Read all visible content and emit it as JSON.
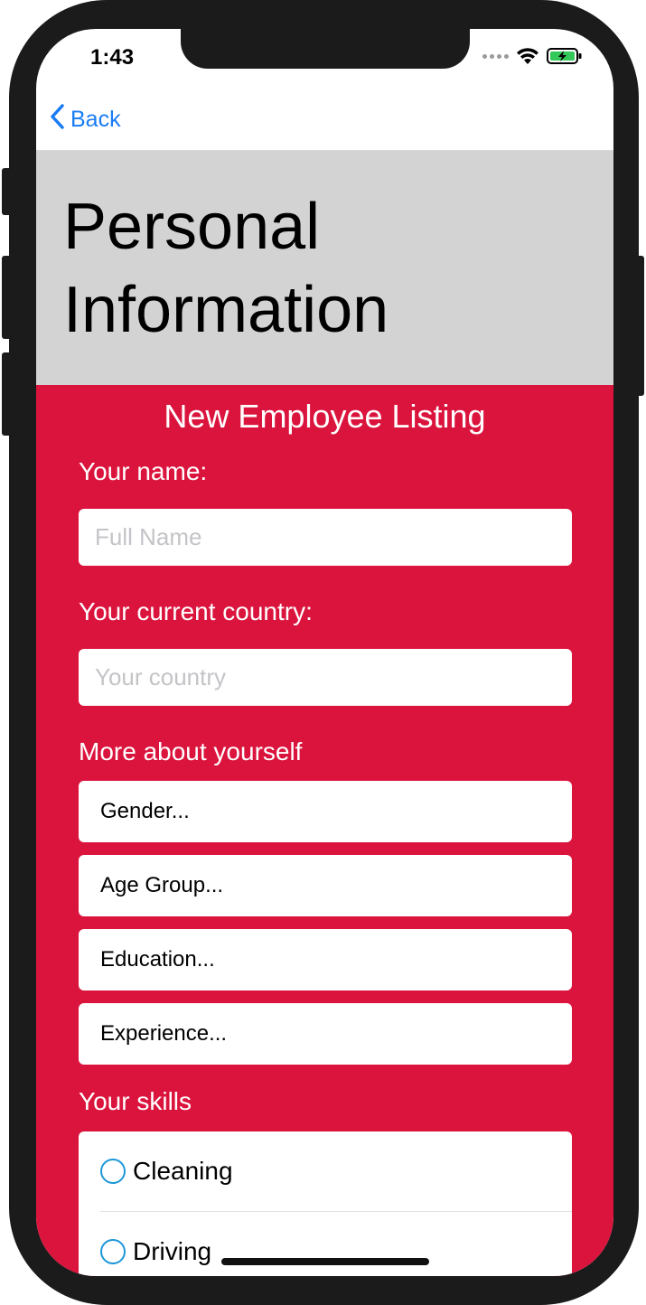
{
  "status_bar": {
    "time": "1:43",
    "signal_icon": "signal-dots-icon",
    "wifi_icon": "wifi-icon",
    "battery_icon": "battery-charging-icon"
  },
  "nav": {
    "back_label": "Back",
    "back_icon": "chevron-left-icon",
    "accent": "#1a7cf5"
  },
  "header": {
    "title": "Personal Information",
    "background": "#d3d3d3"
  },
  "form": {
    "background": "#db143d",
    "listing_title": "New Employee Listing",
    "name_label": "Your name:",
    "name_placeholder": "Full Name",
    "name_value": "",
    "country_label": "Your current country:",
    "country_placeholder": "Your country",
    "country_value": "",
    "more_label": "More about yourself",
    "selects": [
      {
        "label": "Gender..."
      },
      {
        "label": "Age Group..."
      },
      {
        "label": "Education..."
      },
      {
        "label": "Experience..."
      }
    ],
    "skills_label": "Your skills",
    "skills": [
      {
        "label": "Cleaning",
        "checked": false
      },
      {
        "label": "Driving",
        "checked": false
      }
    ]
  }
}
